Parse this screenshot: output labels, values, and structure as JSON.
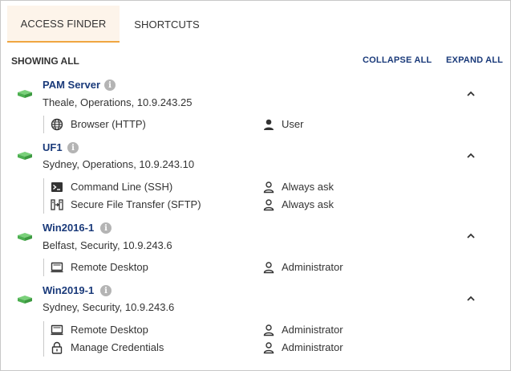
{
  "tabs": [
    {
      "label": "ACCESS FINDER",
      "active": true
    },
    {
      "label": "SHORTCUTS",
      "active": false
    }
  ],
  "toolbar": {
    "showing": "SHOWING ALL",
    "collapse_all": "COLLAPSE ALL",
    "expand_all": "EXPAND ALL"
  },
  "colors": {
    "accent": "#f0a641",
    "link": "#1a3a7a",
    "server_icon": "#5cb85c"
  },
  "servers": [
    {
      "name": "PAM Server",
      "meta": "Theale, Operations, 10.9.243.25",
      "connections": [
        {
          "icon": "globe-icon",
          "label": "Browser (HTTP)",
          "user_icon": "user-solid-icon",
          "user": "User"
        }
      ]
    },
    {
      "name": "UF1",
      "meta": "Sydney, Operations, 10.9.243.10",
      "connections": [
        {
          "icon": "terminal-icon",
          "label": "Command Line (SSH)",
          "user_icon": "user-outline-icon",
          "user": "Always ask"
        },
        {
          "icon": "file-transfer-icon",
          "label": "Secure File Transfer (SFTP)",
          "user_icon": "user-outline-icon",
          "user": "Always ask"
        }
      ]
    },
    {
      "name": "Win2016-1",
      "meta": "Belfast, Security, 10.9.243.6",
      "connections": [
        {
          "icon": "monitor-icon",
          "label": "Remote Desktop",
          "user_icon": "user-outline-icon",
          "user": "Administrator"
        }
      ]
    },
    {
      "name": "Win2019-1",
      "meta": "Sydney, Security, 10.9.243.6",
      "connections": [
        {
          "icon": "monitor-icon",
          "label": "Remote Desktop",
          "user_icon": "user-outline-icon",
          "user": "Administrator"
        },
        {
          "icon": "lock-icon",
          "label": "Manage Credentials",
          "user_icon": "user-outline-icon",
          "user": "Administrator"
        }
      ]
    }
  ]
}
